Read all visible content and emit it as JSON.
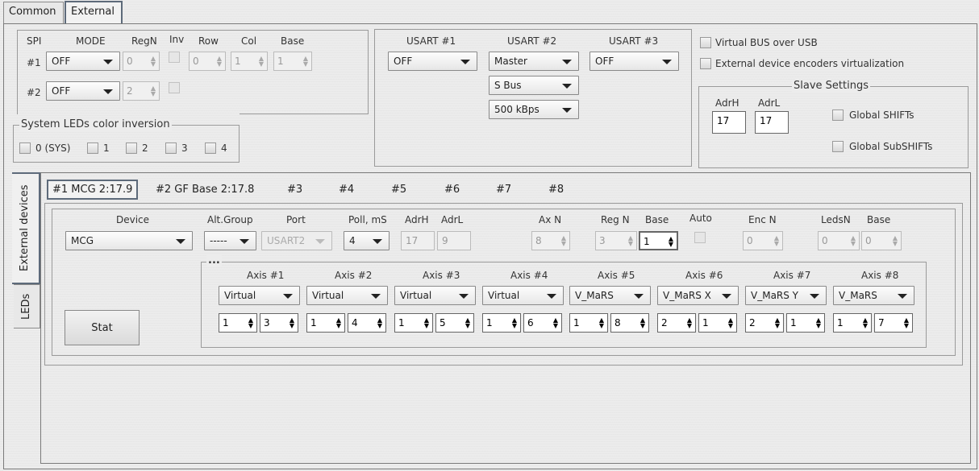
{
  "top_tabs": [
    "Common",
    "External"
  ],
  "spi": {
    "hdr_spi": "SPI",
    "hdr_mode": "MODE",
    "hdr_regn": "RegN",
    "hdr_inv": "Inv",
    "hdr_row": "Row",
    "hdr_col": "Col",
    "hdr_base": "Base",
    "row1": {
      "label": "#1",
      "mode": "OFF",
      "regn": "0",
      "row": "0",
      "col": "1",
      "base": "1"
    },
    "row2": {
      "label": "#2",
      "mode": "OFF",
      "regn": "2"
    }
  },
  "leds": {
    "title": "System LEDs color inversion",
    "items": [
      "0 (SYS)",
      "1",
      "2",
      "3",
      "4"
    ]
  },
  "usart": {
    "h1": "USART #1",
    "h2": "USART #2",
    "h3": "USART #3",
    "u1": "OFF",
    "u2": "Master",
    "u3": "OFF",
    "bus": "S Bus",
    "rate": "500 kBps"
  },
  "right": {
    "vbus": "Virtual BUS over USB",
    "encvirt": "External device encoders virtualization"
  },
  "slave": {
    "title": "Slave Settings",
    "adrh_label": "AdrH",
    "adrl_label": "AdrL",
    "adrh": "17",
    "adrl": "17",
    "gshift": "Global SHIFTs",
    "gsubshift": "Global SubSHIFTs"
  },
  "side_tabs": [
    "External devices",
    "LEDs"
  ],
  "dev_tabs": [
    "#1 MCG 2:17.9",
    "#2 GF Base 2:17.8",
    "#3",
    "#4",
    "#5",
    "#6",
    "#7",
    "#8"
  ],
  "device": {
    "h_device": "Device",
    "h_altgroup": "Alt.Group",
    "h_port": "Port",
    "h_poll": "Poll, mS",
    "h_adrh": "AdrH",
    "h_adrl": "AdrL",
    "h_axn": "Ax N",
    "h_regn": "Reg N",
    "h_base": "Base",
    "h_auto": "Auto",
    "h_encn": "Enc N",
    "h_ledsn": "LedsN",
    "h_base2": "Base",
    "device": "MCG",
    "altgroup": "-----",
    "port": "USART2",
    "poll": "4",
    "adrh": "17",
    "adrl": "9",
    "axn": "8",
    "regn": "3",
    "base": "1",
    "encn": "0",
    "ledsn": "0",
    "base2": "0"
  },
  "axes_title": "...",
  "axes": [
    {
      "label": "Axis #1",
      "type": "Virtual",
      "a": "1",
      "b": "3"
    },
    {
      "label": "Axis #2",
      "type": "Virtual",
      "a": "1",
      "b": "4"
    },
    {
      "label": "Axis #3",
      "type": "Virtual",
      "a": "1",
      "b": "5"
    },
    {
      "label": "Axis #4",
      "type": "Virtual",
      "a": "1",
      "b": "6"
    },
    {
      "label": "Axis #5",
      "type": "V_MaRS",
      "a": "1",
      "b": "8"
    },
    {
      "label": "Axis #6",
      "type": "V_MaRS X",
      "a": "2",
      "b": "1"
    },
    {
      "label": "Axis #7",
      "type": "V_MaRS Y",
      "a": "2",
      "b": "1"
    },
    {
      "label": "Axis #8",
      "type": "V_MaRS",
      "a": "1",
      "b": "7"
    }
  ],
  "stat": "Stat"
}
